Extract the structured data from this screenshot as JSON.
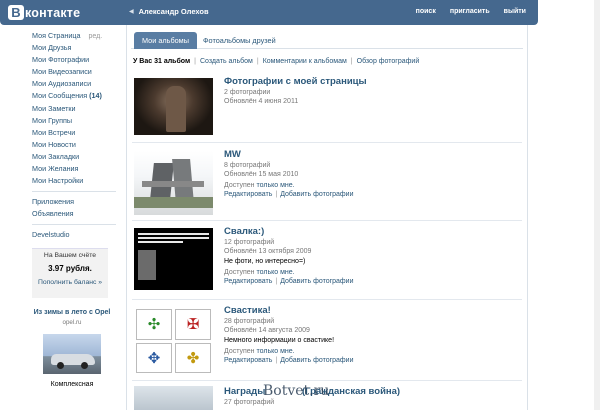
{
  "header": {
    "logo_letter": "В",
    "logo_text": "контакте",
    "user_name": "Александр Олехов",
    "nav": [
      "поиск",
      "пригласить",
      "выйти"
    ]
  },
  "sidebar": {
    "my_page": "Моя Страница",
    "edit": "ред.",
    "items": [
      "Мои Друзья",
      "Мои Фотографии",
      "Мои Видеозаписи",
      "Мои Аудиозаписи"
    ],
    "messages_label": "Мои Сообщения",
    "messages_count": "(14)",
    "items2": [
      "Мои Заметки",
      "Мои Группы",
      "Мои Встречи",
      "Мои Новости",
      "Мои Закладки",
      "Мои Желания",
      "Мои Настройки"
    ],
    "extras": [
      "Приложения",
      "Объявления"
    ],
    "app": "Develstudio",
    "balance": {
      "title": "На Вашем счёте",
      "amount": "3.97 рубля.",
      "action": "Пополнить баланс »"
    },
    "ad": {
      "title": "Из зимы в лето с Opel",
      "url": "opel.ru",
      "text": "Комплексная"
    }
  },
  "tabs": {
    "active": "Мои альбомы",
    "other": "Фотоальбомы друзей"
  },
  "summary": {
    "count": "У Вас 31 альбом",
    "links": [
      "Создать альбом",
      "Комментарии к альбомам",
      "Обзор фотографий"
    ]
  },
  "albums": [
    {
      "name": "Фотографии с моей страницы",
      "count": "2 фотографии",
      "updated": "Обновлён 4 июня 2011"
    },
    {
      "name": "MW",
      "count": "8 фотографий",
      "updated": "Обновлён 15 мая 2010",
      "access_label": "Доступен",
      "access_value": "только мне.",
      "edit": "Редактировать",
      "add": "Добавить фотографии"
    },
    {
      "name": "Свалка:)",
      "count": "12 фотографий",
      "updated": "Обновлён 13 октября 2009",
      "desc": "Не фоти, но интересно=)",
      "access_label": "Доступен",
      "access_value": "только мне.",
      "edit": "Редактировать",
      "add": "Добавить фотографии"
    },
    {
      "name": "Свастика!",
      "count": "28 фотографий",
      "updated": "Обновлён 14 августа 2009",
      "desc": "Немного информации о свастике!",
      "access_label": "Доступен",
      "access_value": "только мне.",
      "edit": "Редактировать",
      "add": "Добавить фотографии"
    },
    {
      "name": "Награды",
      "name_tail": "(Гражданская война)",
      "count": "27 фотографий"
    }
  ],
  "watermark": "Botvet.ru",
  "colors": {
    "header": "#45688e",
    "link": "#2b587a",
    "tab_active": "#597da3"
  }
}
